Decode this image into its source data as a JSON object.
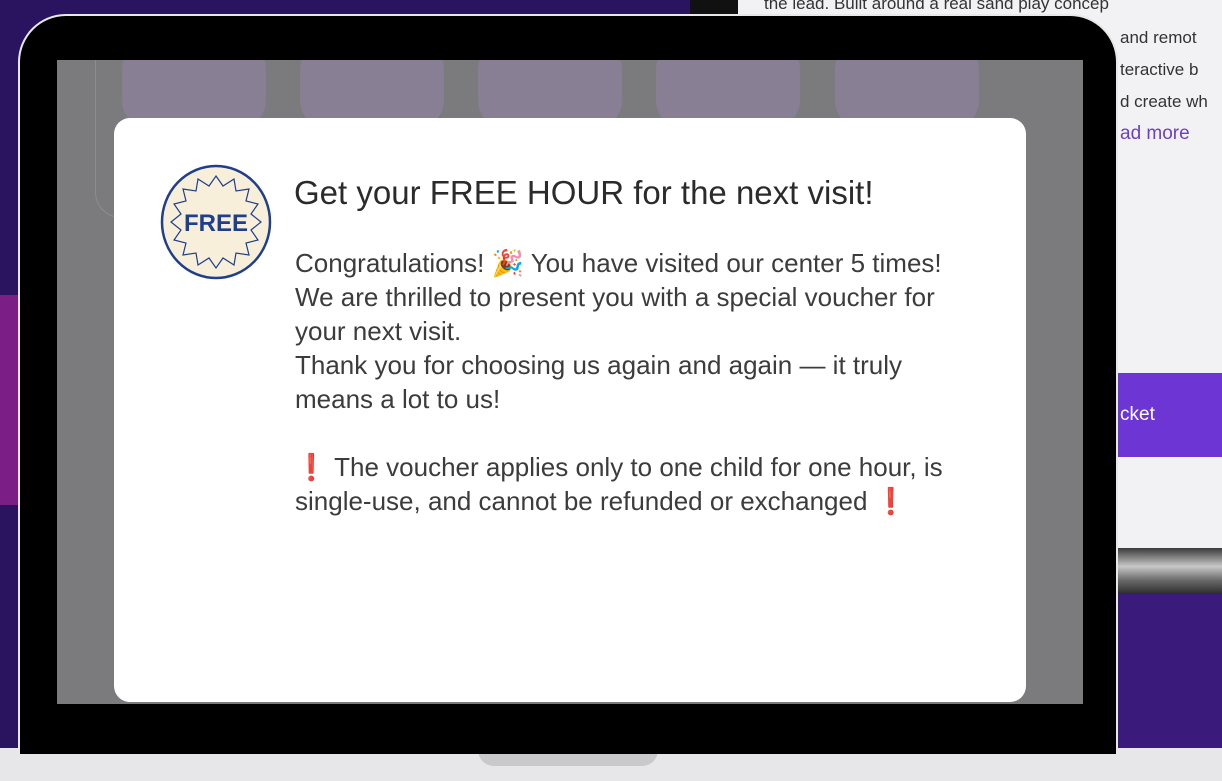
{
  "background": {
    "description_line1": "the lead. Built around a real sand play concep",
    "description_line2": "and remot",
    "description_line3": "teractive b",
    "description_line4": "d create wh",
    "read_more": "ad more",
    "ticket_button": "cket"
  },
  "modal": {
    "badge_text": "FREE",
    "title": "Get your FREE HOUR for the next visit!",
    "congrats_before_emoji": "Congratulations! ",
    "congrats_emoji": "🎉",
    "congrats_after_emoji": " You have visited our center 5 times!",
    "line2": "We are thrilled to present you with a special voucher for your next visit.",
    "line3": "Thank you for choosing us again and again — it truly means a lot to us!",
    "warning_mark": "❗",
    "warning_text": " The voucher applies only to one child for one hour, is single-use, and cannot be refunded or exchanged",
    "warning_mark_end": "❗"
  },
  "colors": {
    "background_purple": "#2a1460",
    "accent_purple": "#6c35d4",
    "warning_red": "#d71920",
    "badge_blue": "#1f3f8c",
    "badge_cream": "#f7efd9"
  }
}
